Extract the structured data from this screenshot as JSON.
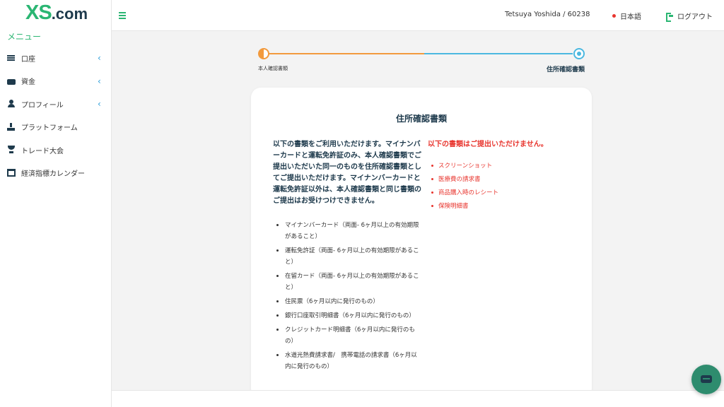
{
  "brand": {
    "logo_main": "XS",
    "logo_suffix": ".com",
    "accent": "#2bb673",
    "dark": "#1e3a4c",
    "alert": "#e8352e"
  },
  "sidebar": {
    "menu_title": "メニュー",
    "items": [
      {
        "label": "口座",
        "icon": "list-icon",
        "expandable": true
      },
      {
        "label": "資金",
        "icon": "wallet-icon",
        "expandable": true
      },
      {
        "label": "プロフィール",
        "icon": "user-icon",
        "expandable": true
      },
      {
        "label": "プラットフォーム",
        "icon": "download-icon",
        "expandable": false
      },
      {
        "label": "トレード大会",
        "icon": "trophy-icon",
        "expandable": false
      },
      {
        "label": "経済指標カレンダー",
        "icon": "calendar-icon",
        "expandable": false
      }
    ],
    "chevron": "‹"
  },
  "header": {
    "user": "Tetsuya Yoshida / 60238",
    "language": "日本語",
    "logout": "ログアウト"
  },
  "stepper": {
    "steps": [
      {
        "label": "本人確認書類",
        "state": "in-progress"
      },
      {
        "label": "住所確認書類",
        "state": "active"
      }
    ]
  },
  "card": {
    "title": "住所確認書類",
    "intro": "以下の書類をご利用いただけます。マイナンバーカードと運転免許証のみ、本人確認書類でご提出いただいた同一のものを住所確認書類としてご提出いただけます。マイナンバーカードと運転免許証以外は、本人確認書類と同じ書類のご提出はお受けつけできません。",
    "accepted": [
      "マイナンバーカード（両面- 6ヶ月以上の有効期限があること）",
      "運転免許証（両面- 6ヶ月以上の有効期限があること）",
      "在留カード（両面- 6ヶ月以上の有効期限があること）",
      "住民票（6ヶ月以内に発行のもの）",
      "銀行口座取引明細書（6ヶ月以内に発行のもの）",
      "クレジットカード明細書（6ヶ月以内に発行のもの）",
      "水道光熱費請求書/　携帯電話の請求書（6ヶ月以内に発行のもの）"
    ],
    "reject_title": "以下の書類はご提出いただけません。",
    "rejected": [
      "スクリーンショット",
      "医療費の請求書",
      "商品購入時のレシート",
      "保険明細書"
    ]
  }
}
